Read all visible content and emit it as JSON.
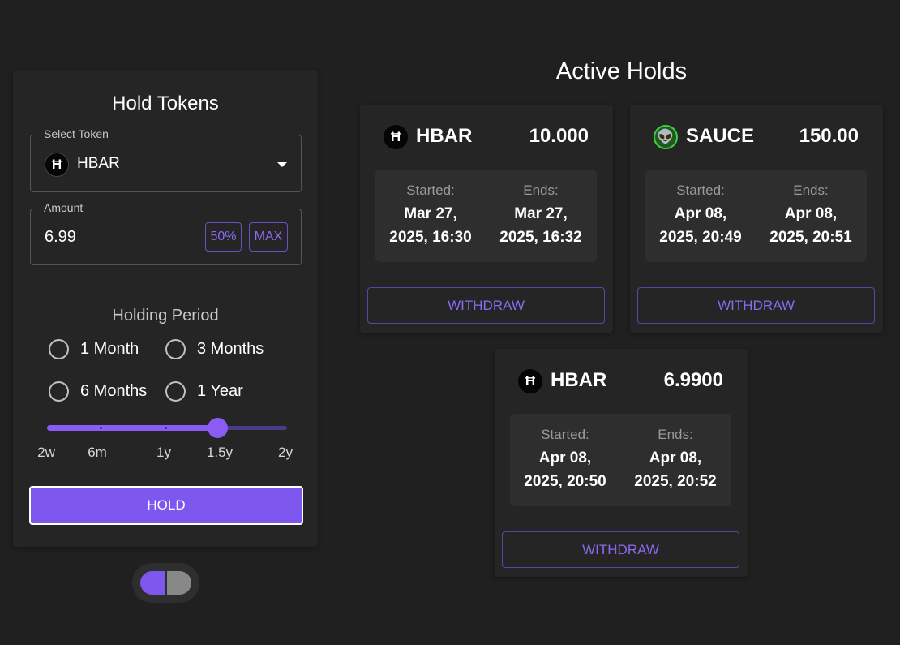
{
  "hold_form": {
    "title": "Hold Tokens",
    "select_token_label": "Select Token",
    "selected_token": "HBAR",
    "selected_token_icon": "hbar-logo-icon",
    "amount_label": "Amount",
    "amount_value": "6.99",
    "btn_50": "50%",
    "btn_max": "MAX",
    "period_title": "Holding Period",
    "period_options": [
      "1 Month",
      "3 Months",
      "6 Months",
      "1 Year"
    ],
    "slider": {
      "marks": [
        "2w",
        "6m",
        "1y",
        "1.5y",
        "2y"
      ],
      "selected": "1.5y"
    },
    "hold_button": "HOLD"
  },
  "theme_toggle": {
    "accent": "#7e57ee"
  },
  "active_holds": {
    "title": "Active Holds",
    "started_label": "Started:",
    "ends_label": "Ends:",
    "withdraw_label": "WITHDRAW",
    "holds": [
      {
        "token": "HBAR",
        "icon": "hbar-logo-icon",
        "amount": "10.000",
        "started_line1": "Mar 27,",
        "started_line2": "2025, 16:30",
        "ends_line1": "Mar 27,",
        "ends_line2": "2025, 16:32"
      },
      {
        "token": "SAUCE",
        "icon": "alien-logo-icon",
        "amount": "150.00",
        "started_line1": "Apr 08,",
        "started_line2": "2025, 20:49",
        "ends_line1": "Apr 08,",
        "ends_line2": "2025, 20:51"
      },
      {
        "token": "HBAR",
        "icon": "hbar-logo-icon",
        "amount": "6.9900",
        "started_line1": "Apr 08,",
        "started_line2": "2025, 20:50",
        "ends_line1": "Apr 08,",
        "ends_line2": "2025, 20:52"
      }
    ]
  },
  "colors": {
    "background": "#202020",
    "panel": "#252525",
    "accent": "#7e57ee",
    "accent_text": "#8a6af0"
  }
}
